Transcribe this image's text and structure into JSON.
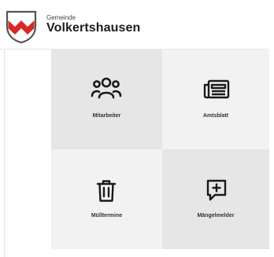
{
  "header": {
    "municipality_prefix": "Gemeinde",
    "municipality_name": "Volkertshausen",
    "crest_icon": "coat-of-arms-icon"
  },
  "tiles": [
    {
      "label": "Mitarbeiter",
      "icon": "people-icon"
    },
    {
      "label": "Amtsblatt",
      "icon": "newspaper-icon"
    },
    {
      "label": "Mülltermine",
      "icon": "trash-icon"
    },
    {
      "label": "Mängelmelder",
      "icon": "report-add-icon"
    }
  ],
  "colors": {
    "crest_red": "#d62a25",
    "crest_outline": "#555555",
    "tile_dark": "#e6e6e6",
    "tile_light": "#f2f2f2",
    "text": "#222222"
  }
}
